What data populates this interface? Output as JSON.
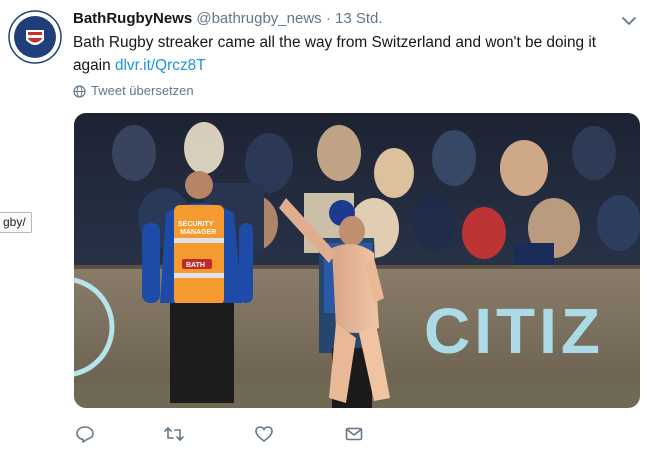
{
  "tweet": {
    "display_name": "BathRugbyNews",
    "handle": "@bathrugby_news",
    "separator": "·",
    "time": "13 Std.",
    "text": "Bath Rugby streaker came all the way from Switzerland and won't be doing it again",
    "link": "dlvr.it/Qrcz8T",
    "translate_label": "Tweet übersetzen"
  },
  "side_tooltip": "gby/",
  "media": {
    "banner_text": "CITIZ",
    "vest_text_1": "SECURITY",
    "vest_text_2": "MANAGER",
    "vest_badge": "BATH"
  },
  "avatar": {
    "logo_text_top": "BATH",
    "logo_text_bottom": "RUGBY"
  },
  "colors": {
    "link": "#1b95e0",
    "muted": "#657786",
    "text": "#14171a",
    "avatar_blue": "#1e3f7a"
  },
  "icons": [
    "chevron-down-icon",
    "globe-icon",
    "reply-icon",
    "retweet-icon",
    "like-icon",
    "message-icon"
  ]
}
